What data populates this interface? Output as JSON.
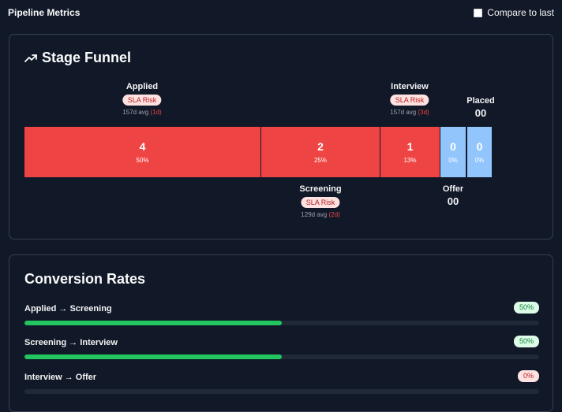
{
  "header": {
    "title": "Pipeline Metrics",
    "compare_label": "Compare to last",
    "compare_checked": false
  },
  "funnel": {
    "title": "Stage Funnel",
    "icon": "trending-up-icon",
    "stages": [
      {
        "name": "Applied",
        "count": "4",
        "percent": "50%",
        "badge": "SLA Risk",
        "avg": "157d avg",
        "late": "(1d)",
        "color": "#ef4444",
        "share": 0.5
      },
      {
        "name": "Screening",
        "count": "2",
        "percent": "25%",
        "badge": "SLA Risk",
        "avg": "129d avg",
        "late": "(2d)",
        "color": "#ef4444",
        "share": 0.25
      },
      {
        "name": "Interview",
        "count": "1",
        "percent": "13%",
        "badge": "SLA Risk",
        "avg": "157d avg",
        "late": "(3d)",
        "color": "#ef4444",
        "share": 0.13
      },
      {
        "name": "Offer",
        "count": "0",
        "percent": "0%",
        "below_count": "00",
        "color": "#93c5fd",
        "share": 0
      },
      {
        "name": "Placed",
        "count": "0",
        "percent": "0%",
        "below_count": "00",
        "color": "#93c5fd",
        "share": 0
      }
    ]
  },
  "conversion": {
    "title": "Conversion Rates",
    "rows": [
      {
        "label": "Applied → Screening",
        "rate": "50%",
        "value": 0.5,
        "status": "good"
      },
      {
        "label": "Screening → Interview",
        "rate": "50%",
        "value": 0.5,
        "status": "good"
      },
      {
        "label": "Interview → Offer",
        "rate": "0%",
        "value": 0,
        "status": "bad"
      }
    ]
  }
}
